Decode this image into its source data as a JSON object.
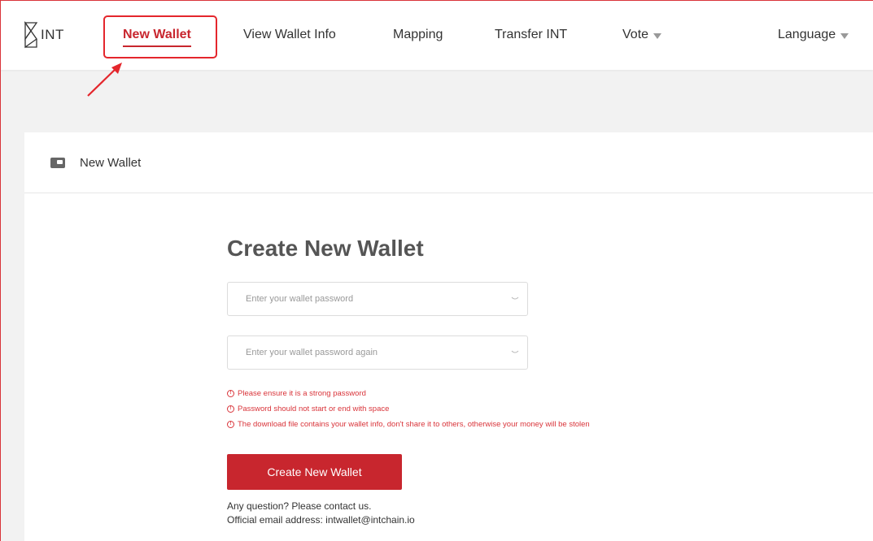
{
  "nav": {
    "logo_text": "INT",
    "items": [
      {
        "label": "New Wallet",
        "active": true
      },
      {
        "label": "View Wallet Info"
      },
      {
        "label": "Mapping"
      },
      {
        "label": "Transfer INT"
      },
      {
        "label": "Vote",
        "dropdown": true
      },
      {
        "label": "Language",
        "dropdown": true
      }
    ]
  },
  "card": {
    "title": "New Wallet",
    "icon": "wallet-icon"
  },
  "form": {
    "title": "Create New Wallet",
    "password_placeholder": "Enter your wallet password",
    "password_value": "",
    "password_again_placeholder": "Enter your wallet password again",
    "password_again_value": "",
    "warnings": [
      "Please ensure it is a strong password",
      "Password should not start or end with space",
      "The download file contains your wallet info, don't share it to others, otherwise your money will be stolen"
    ],
    "submit_label": "Create New Wallet",
    "contact_line1": "Any question? Please contact us.",
    "contact_line2": "Official email address: intwallet@intchain.io"
  },
  "colors": {
    "brand": "#c8262e",
    "warning": "#d9343a",
    "annotation": "#e4262c"
  }
}
